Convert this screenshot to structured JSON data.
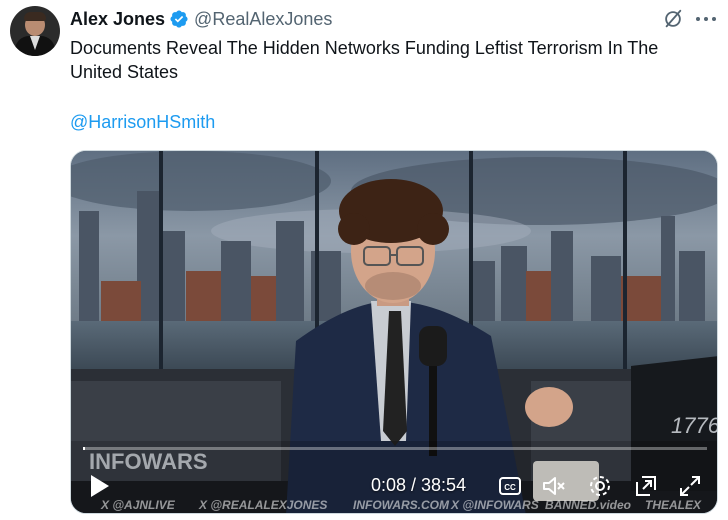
{
  "tweet": {
    "author_name": "Alex Jones",
    "author_handle": "@RealAlexJones",
    "text": "Documents Reveal The Hidden Networks Funding Leftist Terrorism In The United States",
    "mention": "@HarrisonHSmith",
    "icons": {
      "verified": "verified-badge-icon",
      "grok": "grok-icon",
      "more": "more-options-icon"
    }
  },
  "video": {
    "current_time": "0:08",
    "duration": "38:54",
    "time_display": "0:08 / 38:54",
    "progress_fraction": 0.0034,
    "watermarks": {
      "logo": "INFOWARS",
      "w1": "X @AJNLIVE",
      "w2": "X @REALALEXJONES",
      "w3": "INFOWARS.COM",
      "w4": "X @INFOWARS",
      "w5": "BANNED.video",
      "w6": "THEALEX"
    },
    "controls": [
      "play-icon",
      "captions-icon",
      "muted-volume-icon",
      "settings-gear-icon",
      "picture-in-picture-icon",
      "fullscreen-icon"
    ]
  },
  "colors": {
    "link": "#1d9bf0",
    "verified": "#1d9bf0",
    "secondary_text": "#536471"
  }
}
